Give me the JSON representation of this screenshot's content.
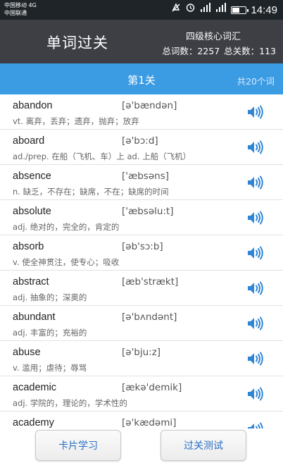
{
  "status_bar": {
    "carrier1": "中国移动 4G",
    "carrier2": "中国联通",
    "time": "14:49",
    "battery_level": 0.55,
    "icons": [
      "no-notification-icon",
      "alarm-icon",
      "signal-icon",
      "signal-icon",
      "battery-icon"
    ]
  },
  "header": {
    "title": "单词过关",
    "book": "四级核心词汇",
    "total_words_label": "总词数：2257",
    "total_levels_label": "总关数：113"
  },
  "level": {
    "title": "第1关",
    "count": "共20个词"
  },
  "words": [
    {
      "word": "abandon",
      "phonetic": "[ə'bændən]",
      "meaning": "vt. 离弃，丢弃；遗弃，抛弃；放弃"
    },
    {
      "word": "aboard",
      "phonetic": "[ə'bɔ:d]",
      "meaning": "ad./prep. 在船（飞机、车）上 ad. 上船（飞机）"
    },
    {
      "word": "absence",
      "phonetic": "['æbsəns]",
      "meaning": "n. 缺乏，不存在；缺席，不在；缺席的时间"
    },
    {
      "word": "absolute",
      "phonetic": "['æbsəlu:t]",
      "meaning": "adj. 绝对的，完全的，肯定的"
    },
    {
      "word": "absorb",
      "phonetic": "[əb'sɔ:b]",
      "meaning": "v. 使全神贯注，使专心；吸收"
    },
    {
      "word": "abstract",
      "phonetic": "[æb'strækt]",
      "meaning": "adj. 抽象的；深奥的"
    },
    {
      "word": "abundant",
      "phonetic": "[ə'bʌndənt]",
      "meaning": "adj. 丰富的；充裕的"
    },
    {
      "word": "abuse",
      "phonetic": "[ə'bju:z]",
      "meaning": "v. 滥用；虐待；辱骂"
    },
    {
      "word": "academic",
      "phonetic": "[ækə'demik]",
      "meaning": "adj. 学院的，理论的，学术性的"
    },
    {
      "word": "academy",
      "phonetic": "[ə'kædəmi]",
      "meaning": ""
    }
  ],
  "buttons": {
    "card_study": "卡片学习",
    "level_test": "过关测试"
  },
  "colors": {
    "header_bg": "#3d3f45",
    "level_bar_bg": "#3b9be3",
    "speaker_icon": "#2f86d6",
    "button_text": "#2a6fc2"
  }
}
